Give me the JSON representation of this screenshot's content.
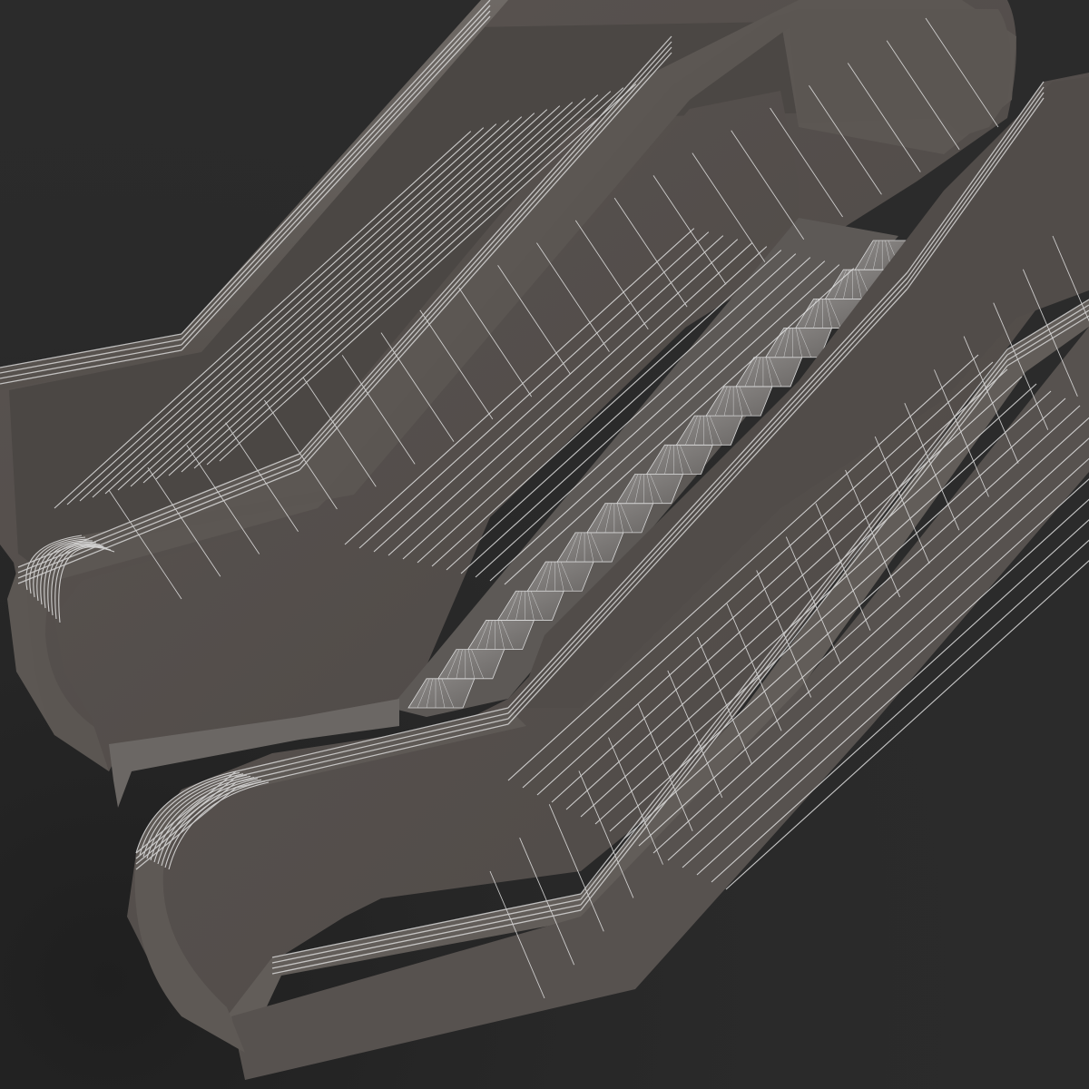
{
  "scene": {
    "subject": "escalator-wireframe-render",
    "colors": {
      "background": "#2b2b2b",
      "background_shadow": "#262626",
      "panel": "#57524f",
      "panel_dark": "#45413f",
      "rail": "#5e5955",
      "rail_top": "#6b6662",
      "inner_wall": "#4a4644",
      "steps": "#7d7a78",
      "wire": "#e6e6e6",
      "wire_dense": "#d0d0d0"
    }
  }
}
